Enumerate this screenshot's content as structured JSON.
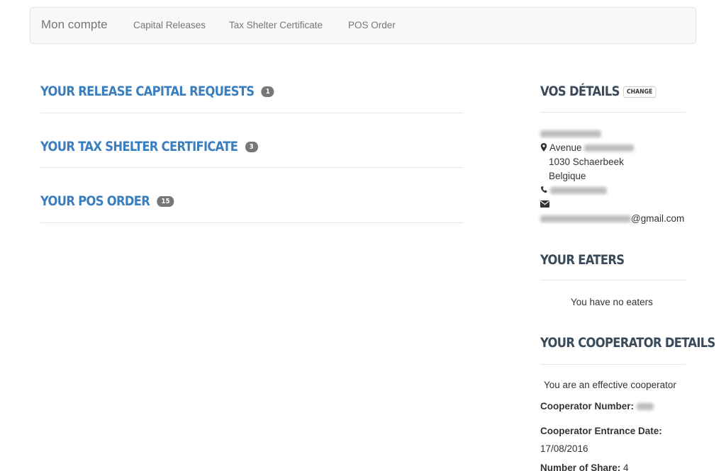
{
  "nav": {
    "brand": "Mon compte",
    "links": [
      "Capital Releases",
      "Tax Shelter Certificate",
      "POS Order"
    ]
  },
  "sections": [
    {
      "title": "Your Release Capital Requests",
      "count": "1"
    },
    {
      "title": "Your Tax Shelter Certificate",
      "count": "3"
    },
    {
      "title": "Your POS Order",
      "count": "15"
    }
  ],
  "details": {
    "title": "Vos détails",
    "change_label": "CHANGE",
    "street_prefix": "Avenue",
    "postal_city": "1030 Schaerbeek",
    "country": "Belgique",
    "email_domain": "@gmail.com"
  },
  "eaters": {
    "title": "Your Eaters",
    "empty_text": "You have no eaters"
  },
  "cooperator": {
    "title": "Your Cooperator Details",
    "status": "You are an effective cooperator",
    "number_label": "Cooperator Number:",
    "entrance_label": "Cooperator Entrance Date:",
    "entrance_date": "17/08/2016",
    "shares_label": "Number of Share:",
    "shares_value": "4"
  },
  "colors": {
    "accent": "#3a7ebf",
    "heading_dark": "#3a4a5a",
    "badge": "#777777"
  }
}
